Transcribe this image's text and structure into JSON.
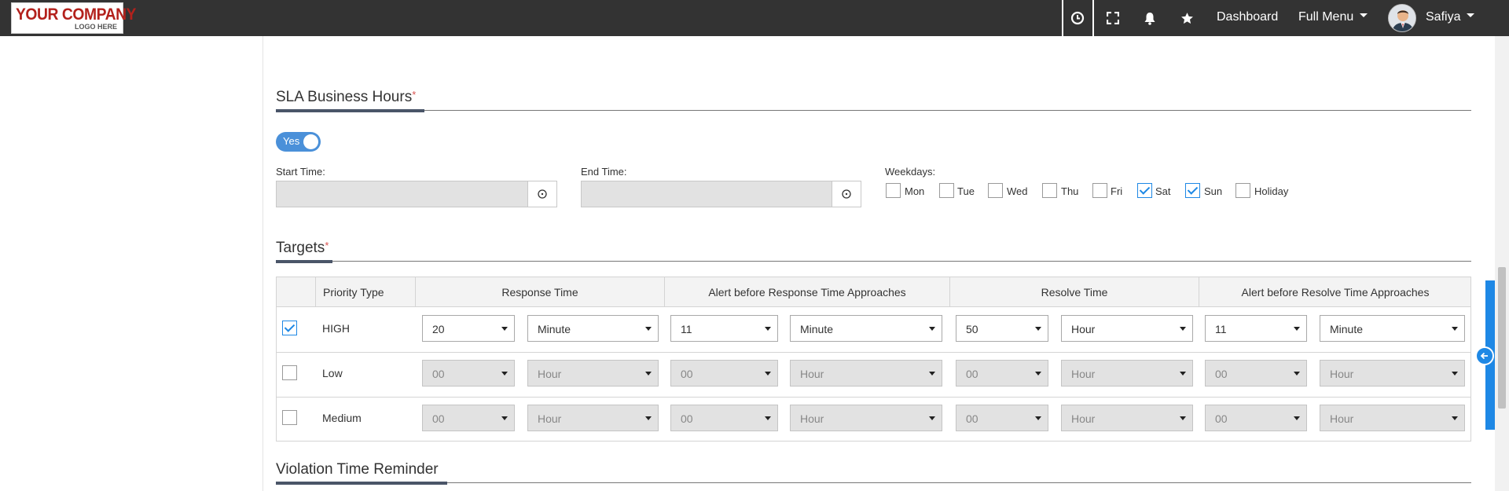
{
  "header": {
    "logo_line1": "YOUR COMPANY",
    "logo_line2": "LOGO HERE",
    "icons": [
      "clock-icon",
      "fullscreen-icon",
      "bell-icon",
      "star-icon"
    ],
    "dashboard_label": "Dashboard",
    "full_menu_label": "Full Menu",
    "user_name": "Safiya"
  },
  "sla_hours": {
    "title": "SLA Business Hours",
    "required_mark": "*",
    "toggle_label": "Yes",
    "toggle_on": true,
    "start_time_label": "Start Time:",
    "start_time_value": "",
    "end_time_label": "End Time:",
    "end_time_value": "",
    "weekdays_label": "Weekdays:",
    "weekdays": [
      {
        "label": "Mon",
        "checked": false
      },
      {
        "label": "Tue",
        "checked": false
      },
      {
        "label": "Wed",
        "checked": false
      },
      {
        "label": "Thu",
        "checked": false
      },
      {
        "label": "Fri",
        "checked": false
      },
      {
        "label": "Sat",
        "checked": true
      },
      {
        "label": "Sun",
        "checked": true
      },
      {
        "label": "Holiday",
        "checked": false
      }
    ]
  },
  "targets": {
    "title": "Targets",
    "required_mark": "*",
    "columns": [
      "Priority Type",
      "Response Time",
      "Alert before Response Time Approaches",
      "Resolve Time",
      "Alert before Resolve Time Approaches"
    ],
    "rows": [
      {
        "priority": "HIGH",
        "checked": true,
        "enabled": true,
        "values": [
          "20",
          "Minute",
          "11",
          "Minute",
          "50",
          "Hour",
          "11",
          "Minute"
        ]
      },
      {
        "priority": "Low",
        "checked": false,
        "enabled": false,
        "values": [
          "00",
          "Hour",
          "00",
          "Hour",
          "00",
          "Hour",
          "00",
          "Hour"
        ]
      },
      {
        "priority": "Medium",
        "checked": false,
        "enabled": false,
        "values": [
          "00",
          "Hour",
          "00",
          "Hour",
          "00",
          "Hour",
          "00",
          "Hour"
        ]
      }
    ]
  },
  "violation": {
    "title": "Violation Time Reminder"
  },
  "colors": {
    "navbar": "#333333",
    "accent": "#1e88e5",
    "toggle": "#4a90d9",
    "required": "#d9534f"
  }
}
